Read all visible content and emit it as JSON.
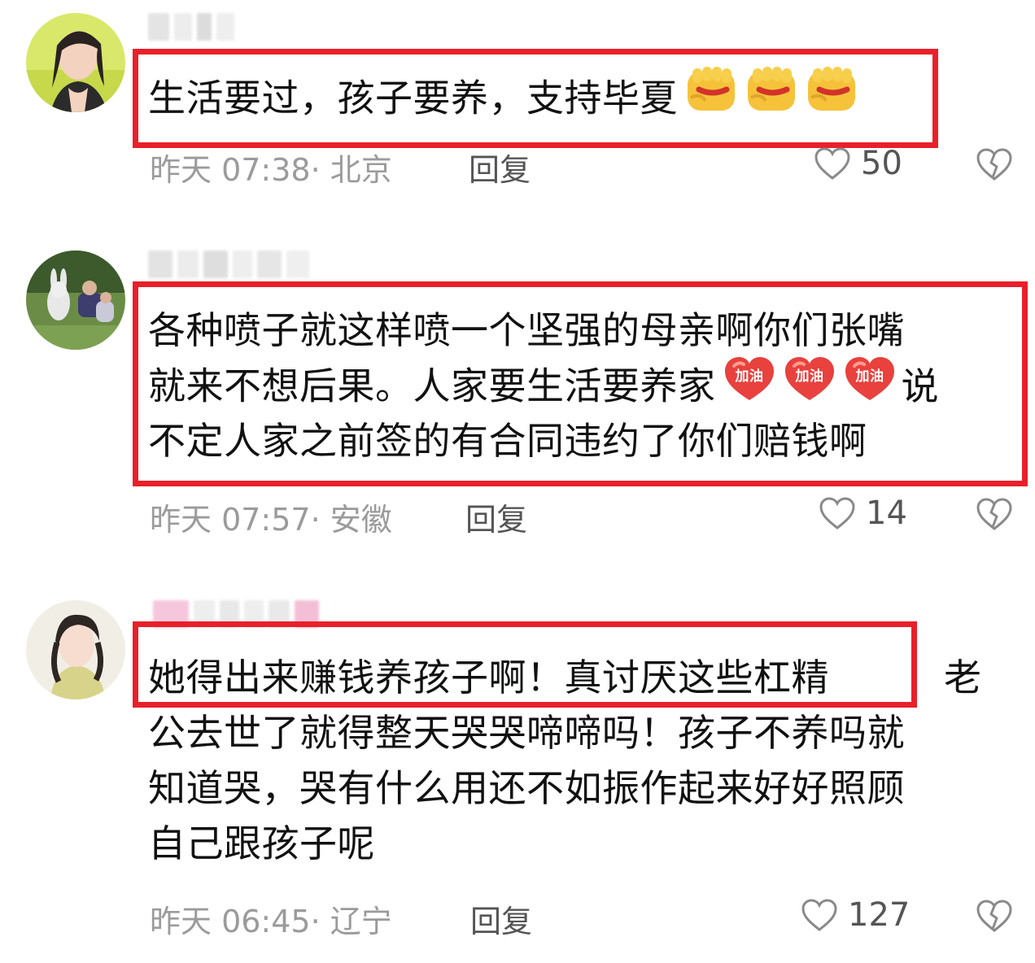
{
  "comments": [
    {
      "lines": [
        [
          "生活要过，孩子要养，支持毕夏"
        ]
      ],
      "emojis": [
        "fist-emoji",
        "fist-emoji",
        "fist-emoji"
      ],
      "time": "昨天 07:38",
      "location": "北京",
      "reply_label": "回复",
      "likes": "50"
    },
    {
      "line1": "各种喷子就这样喷一个坚强的母亲啊你们张嘴",
      "line2": "就来不想后果。人家要生活要养家",
      "line2_end": "说",
      "line3": "不定人家之前签的有合同违约了你们赔钱啊",
      "badge_text": "加油",
      "time": "昨天 07:57",
      "location": "安徽",
      "reply_label": "回复",
      "likes": "14"
    },
    {
      "line1": "她得出来赚钱养孩子啊！真讨厌这些杠精",
      "line1_tail": "老",
      "line2": "公去世了就得整天哭哭啼啼吗！孩子不养吗就",
      "line3": "知道哭，哭有什么用还不如振作起来好好照顾",
      "line4": "自己跟孩子呢",
      "time": "昨天 06:45",
      "location": "辽宁",
      "reply_label": "回复",
      "likes": "127"
    }
  ],
  "colors": {
    "highlight_border": "#e8202a",
    "meta_text": "#9b9b9b",
    "body_text": "#111111"
  }
}
